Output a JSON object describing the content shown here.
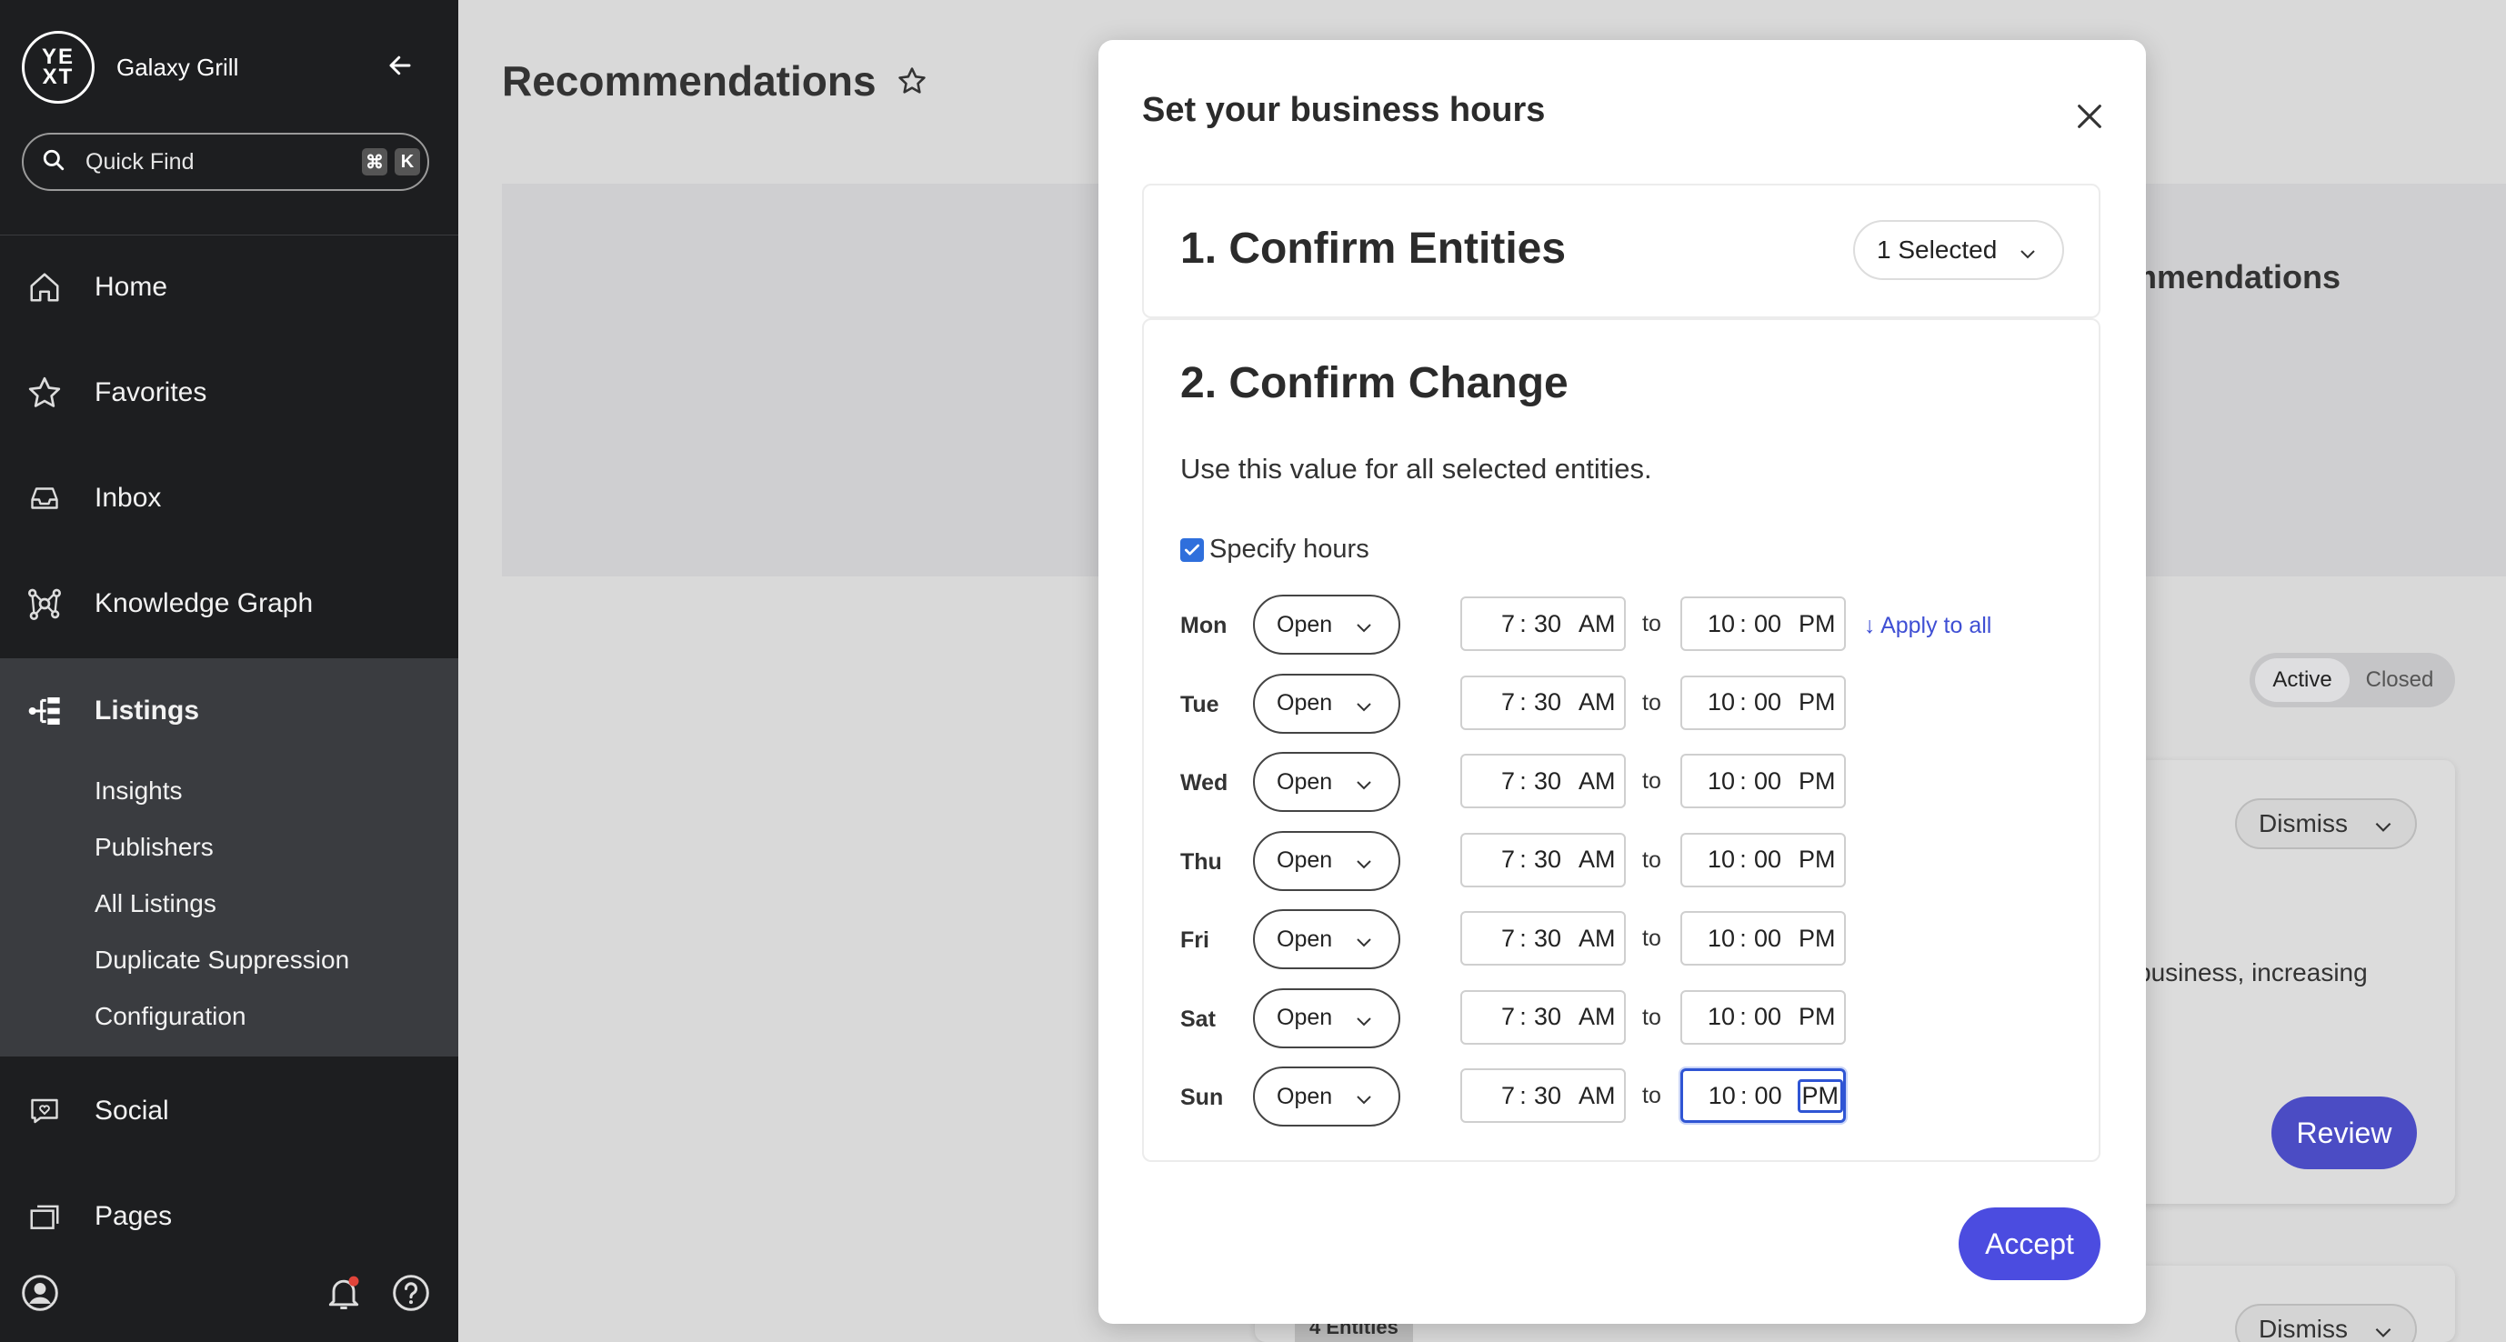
{
  "sidebar": {
    "logo_text": "YE XT",
    "brand_name": "Galaxy Grill",
    "quick_find": {
      "label": "Quick Find",
      "key1": "⌘",
      "key2": "K"
    },
    "nav": [
      {
        "label": "Home",
        "icon": "home-icon"
      },
      {
        "label": "Favorites",
        "icon": "star-icon"
      },
      {
        "label": "Inbox",
        "icon": "inbox-icon"
      },
      {
        "label": "Knowledge Graph",
        "icon": "knowledge-graph-icon"
      },
      {
        "label": "Listings",
        "icon": "listings-icon",
        "active": true
      },
      {
        "label": "Social",
        "icon": "social-icon"
      },
      {
        "label": "Pages",
        "icon": "pages-icon"
      }
    ],
    "listings_sub": [
      "Insights",
      "Publishers",
      "All Listings",
      "Duplicate Suppression",
      "Configuration"
    ]
  },
  "page": {
    "title": "Recommendations",
    "partial_heading": "mmendations",
    "toggle": {
      "active": "Active",
      "closed": "Closed"
    },
    "dismiss_label": "Dismiss",
    "card_text": "business, increasing",
    "review_label": "Review",
    "entities_tag": "4 Entities"
  },
  "modal": {
    "title": "Set your business hours",
    "section1_title": "1. Confirm Entities",
    "selected_label": "1 Selected",
    "section2_title": "2. Confirm Change",
    "description": "Use this value for all selected entities.",
    "specify_hours_label": "Specify hours",
    "specify_hours_checked": true,
    "to_label": "to",
    "apply_all_label": "↓ Apply to all",
    "days": [
      {
        "day": "Mon",
        "status": "Open",
        "open_h": "7",
        "open_m": "30",
        "open_ap": "AM",
        "close_h": "10",
        "close_m": "00",
        "close_ap": "PM"
      },
      {
        "day": "Tue",
        "status": "Open",
        "open_h": "7",
        "open_m": "30",
        "open_ap": "AM",
        "close_h": "10",
        "close_m": "00",
        "close_ap": "PM"
      },
      {
        "day": "Wed",
        "status": "Open",
        "open_h": "7",
        "open_m": "30",
        "open_ap": "AM",
        "close_h": "10",
        "close_m": "00",
        "close_ap": "PM"
      },
      {
        "day": "Thu",
        "status": "Open",
        "open_h": "7",
        "open_m": "30",
        "open_ap": "AM",
        "close_h": "10",
        "close_m": "00",
        "close_ap": "PM"
      },
      {
        "day": "Fri",
        "status": "Open",
        "open_h": "7",
        "open_m": "30",
        "open_ap": "AM",
        "close_h": "10",
        "close_m": "00",
        "close_ap": "PM"
      },
      {
        "day": "Sat",
        "status": "Open",
        "open_h": "7",
        "open_m": "30",
        "open_ap": "AM",
        "close_h": "10",
        "close_m": "00",
        "close_ap": "PM"
      },
      {
        "day": "Sun",
        "status": "Open",
        "open_h": "7",
        "open_m": "30",
        "open_ap": "AM",
        "close_h": "10",
        "close_m": "00",
        "close_ap": "PM"
      }
    ],
    "time_sep": ":",
    "accept_label": "Accept"
  },
  "colors": {
    "accent": "#4b4ce0",
    "sidebar_bg": "#1d1e20",
    "link": "#3f4fd4"
  }
}
